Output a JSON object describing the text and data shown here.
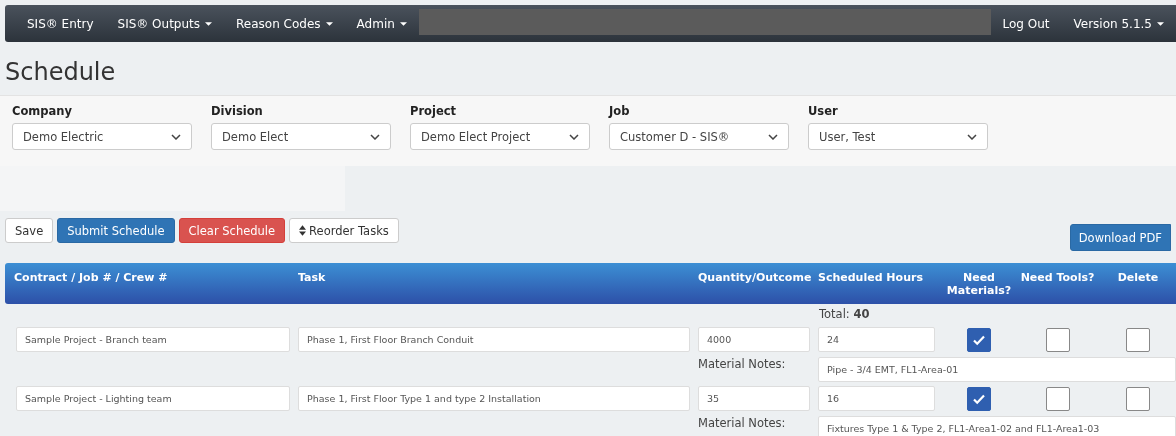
{
  "navbar": {
    "items": [
      {
        "label": "SIS® Entry",
        "dropdown": false
      },
      {
        "label": "SIS® Outputs",
        "dropdown": true
      },
      {
        "label": "Reason Codes",
        "dropdown": true
      },
      {
        "label": "Admin",
        "dropdown": true
      }
    ],
    "right_items": [
      {
        "label": "Log Out",
        "dropdown": false
      },
      {
        "label": "Version 5.1.5",
        "dropdown": true
      }
    ]
  },
  "page_title": "Schedule",
  "filters": [
    {
      "label": "Company",
      "value": "Demo Electric"
    },
    {
      "label": "Division",
      "value": "Demo Elect"
    },
    {
      "label": "Project",
      "value": "Demo Elect Project"
    },
    {
      "label": "Job",
      "value": "Customer D - SIS®"
    },
    {
      "label": "User",
      "value": "User, Test"
    }
  ],
  "actions": [
    {
      "label": "Save",
      "kind": "default"
    },
    {
      "label": "Submit Schedule",
      "kind": "primary"
    },
    {
      "label": "Clear Schedule",
      "kind": "danger"
    },
    {
      "label": "Reorder Tasks",
      "kind": "reorder"
    }
  ],
  "download_button": "Download PDF",
  "table": {
    "columns": [
      "Contract / Job # / Crew #",
      "Task",
      "Quantity/Outcome",
      "Scheduled Hours",
      "Need Materials?",
      "Need Tools?",
      "Delete"
    ],
    "total_label": "Total:",
    "total_value": "40",
    "rows": [
      {
        "crew": "Sample Project - Branch team",
        "task": "Phase 1, First Floor Branch Conduit",
        "quantity": "4000",
        "hours": "24",
        "need_materials": true,
        "need_tools": false,
        "delete": false,
        "notes_label": "Material Notes:",
        "notes": "Pipe - 3/4 EMT, FL1-Area-01"
      },
      {
        "crew": "Sample Project - Lighting team",
        "task": "Phase 1, First Floor Type 1 and type 2 Installation",
        "quantity": "35",
        "hours": "16",
        "need_materials": true,
        "need_tools": false,
        "delete": false,
        "notes_label": "Material Notes:",
        "notes": "Fixtures Type 1 & Type 2, FL1-Area1-02 and FL1-Area1-03"
      }
    ]
  }
}
